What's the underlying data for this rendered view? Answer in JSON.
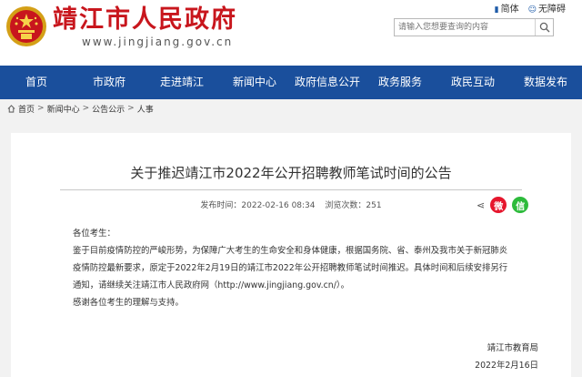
{
  "header": {
    "site_name": "靖江市人民政府",
    "site_domain": "www.jingjiang.gov.cn",
    "utility": [
      {
        "icon": "mobile-icon",
        "label": "简体"
      },
      {
        "icon": "accessibility-icon",
        "label": "无障碍"
      }
    ],
    "search_placeholder": "请输入您想要查询的内容"
  },
  "nav": {
    "items": [
      "首页",
      "市政府",
      "走进靖江",
      "新闻中心",
      "政府信息公开",
      "政务服务",
      "政民互动",
      "数据发布"
    ]
  },
  "breadcrumb": {
    "items": [
      "首页",
      "新闻中心",
      "公告公示",
      "人事"
    ],
    "separator": ">"
  },
  "article": {
    "title": "关于推迟靖江市2022年公开招聘教师笔试时间的公告",
    "publish_label": "发布时间：2022-02-16 08:34",
    "views_label": "浏览次数：251",
    "greeting": "各位考生：",
    "paragraph": "鉴于目前疫情防控的严峻形势，为保障广大考生的生命安全和身体健康，根据国务院、省、泰州及我市关于新冠肺炎疫情防控最新要求，原定于2022年2月19日的靖江市2022年公开招聘教师笔试时间推迟。具体时间和后续安排另行通知，请继续关注靖江市人民政府网（http://www.jingjiang.gov.cn/）。",
    "thanks": "感谢各位考生的理解与支持。",
    "signature_org": "靖江市教育局",
    "signature_date": "2022年2月16日"
  },
  "colors": {
    "brand_red": "#c8161d",
    "nav_blue": "#1a4f9c",
    "weibo": "#e6162d",
    "wechat": "#2dbb3b"
  }
}
